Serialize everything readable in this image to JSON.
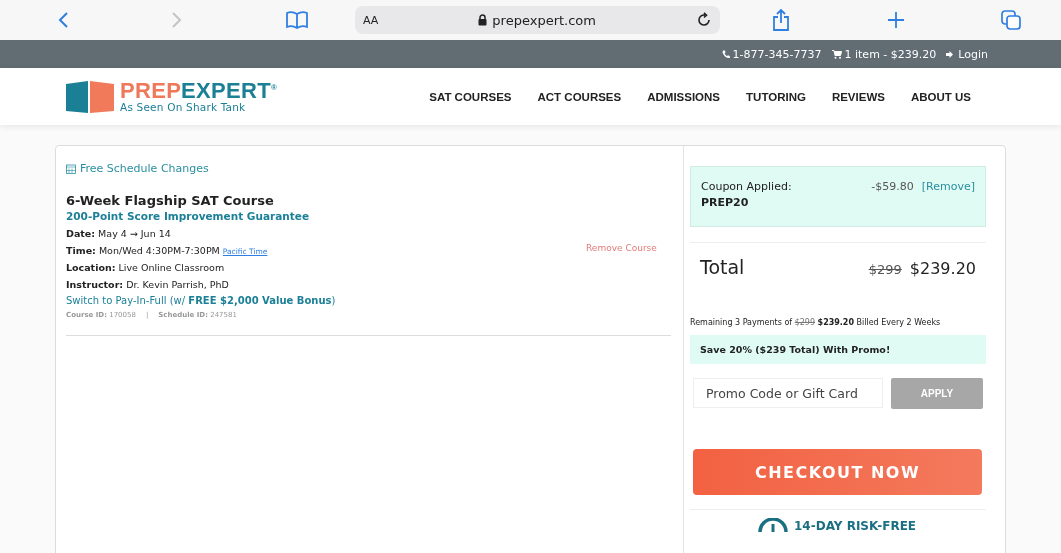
{
  "browser": {
    "text_size": "AA",
    "address": "prepexpert.com"
  },
  "topbar": {
    "phone": "1-877-345-7737",
    "cart": "1 item - $239.20",
    "login": "Login"
  },
  "logo": {
    "first": "PREP",
    "second": "EXPERT",
    "mark": "®",
    "tagline": "As Seen On Shark Tank"
  },
  "nav": [
    "SAT COURSES",
    "ACT COURSES",
    "ADMISSIONS",
    "TUTORING",
    "REVIEWS",
    "ABOUT US"
  ],
  "course": {
    "schedule_link": "Free Schedule Changes",
    "title": "6-Week Flagship SAT Course",
    "guarantee": "200-Point Score Improvement Guarantee",
    "details": [
      {
        "text": "**Date:** May 4 → Jun 14"
      },
      {
        "text": "**Time:** Mon/Wed 4:30PM-7:30PM",
        "link": "Pacific Time"
      },
      {
        "text": "**Location:** Live Online Classroom"
      },
      {
        "text": "**Instructor:** Dr. Kevin Parrish, PhD"
      }
    ],
    "pay_in_full": "Switch to Pay-In-Full (w/ **FREE $2,000 Value Bonus**)",
    "course_id": "**Course ID:** 170058",
    "separator": "|",
    "schedule_id": "**Schedule ID:** 247581",
    "remove": "Remove Course"
  },
  "summary": {
    "coupon_label": "Coupon Applied:",
    "coupon_code": "PREP20",
    "discount": "-$59.80",
    "coupon_remove": "[Remove]",
    "total_label": "Total",
    "total_old": "$299",
    "total_new": "$239.20",
    "remaining": "Remaining 3 Payments of",
    "remaining_old": "$299",
    "remaining_new": "$239.20",
    "remaining_tail": "Billed Every 2 Weeks",
    "save_banner": "Save 20% ($239 Total) With Promo!",
    "promo_placeholder": "Promo Code or Gift Card",
    "apply": "APPLY",
    "checkout": "CHECKOUT NOW",
    "risk_free": "14-DAY RISK-FREE"
  }
}
